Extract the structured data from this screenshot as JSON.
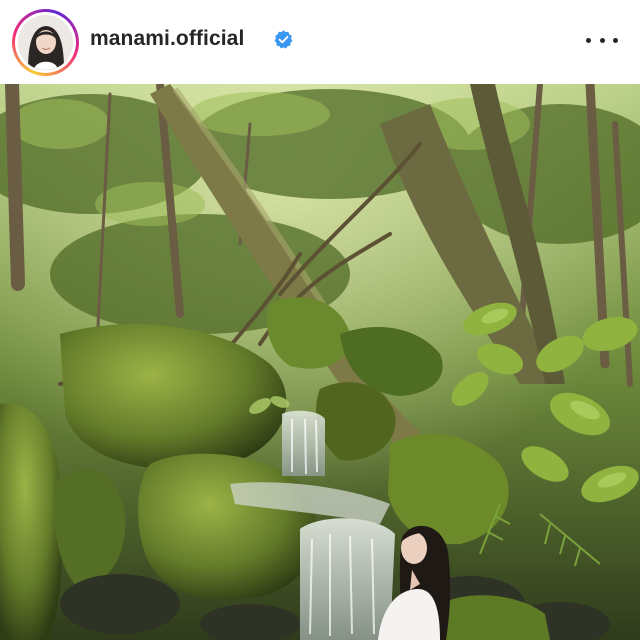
{
  "post_header": {
    "username": "manami.official",
    "verified": true,
    "more_icon": "more-horizontal-icon"
  },
  "colors": {
    "verified_badge": "#3897f0",
    "username_text": "#262626",
    "ring_gradient": [
      "#f9ce34",
      "#ee2a7b",
      "#6228d7"
    ]
  }
}
